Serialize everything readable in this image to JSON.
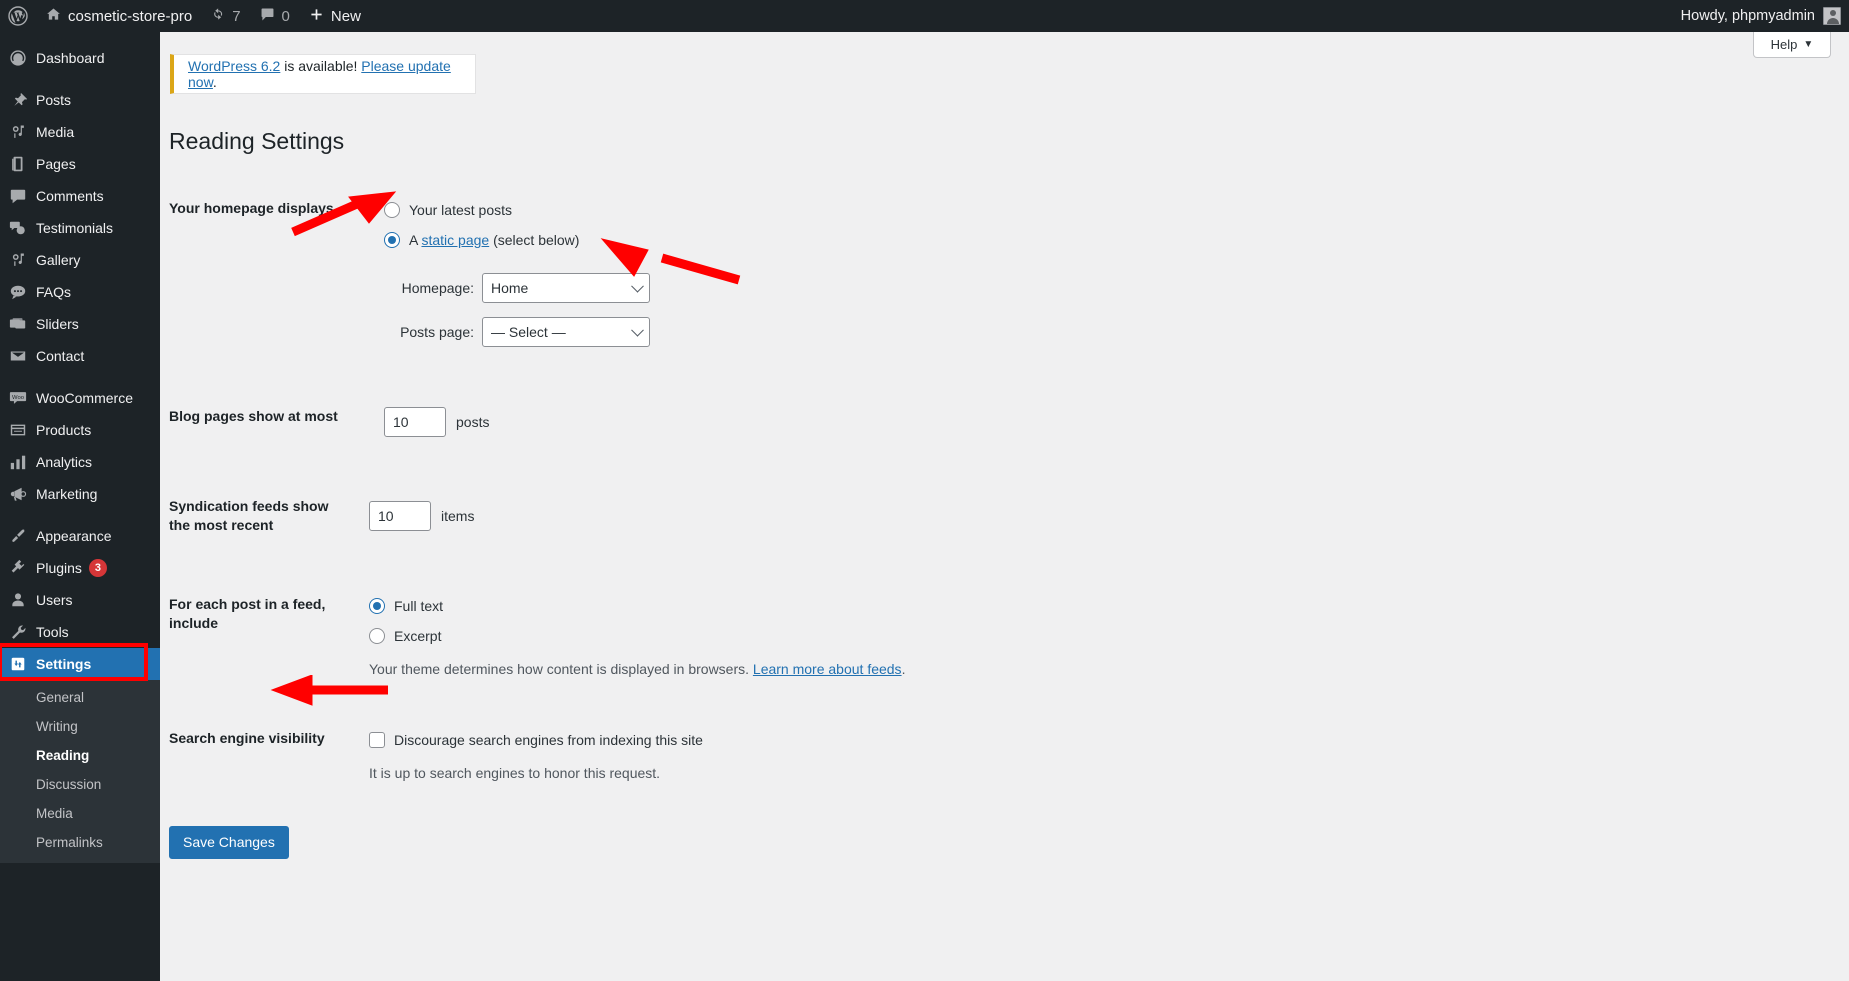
{
  "adminbar": {
    "logo_icon": "wordpress-logo-icon",
    "site_icon": "home-icon",
    "site_name": "cosmetic-store-pro",
    "updates_icon": "updates-icon",
    "updates_count": "7",
    "comments_icon": "comment-bubble-icon",
    "comments_count": "0",
    "new_icon": "plus-icon",
    "new_label": "New",
    "howdy": "Howdy, phpmyadmin",
    "avatar": "user-avatar"
  },
  "sidebar": {
    "items": [
      {
        "label": "Dashboard",
        "icon": "dashboard-icon",
        "sep_after": true
      },
      {
        "label": "Posts",
        "icon": "pin-icon"
      },
      {
        "label": "Media",
        "icon": "media-icon"
      },
      {
        "label": "Pages",
        "icon": "pages-icon"
      },
      {
        "label": "Comments",
        "icon": "comments-icon"
      },
      {
        "label": "Testimonials",
        "icon": "testimonials-icon"
      },
      {
        "label": "Gallery",
        "icon": "gallery-icon"
      },
      {
        "label": "FAQs",
        "icon": "faqs-icon"
      },
      {
        "label": "Sliders",
        "icon": "sliders-icon"
      },
      {
        "label": "Contact",
        "icon": "envelope-icon",
        "sep_after": true
      },
      {
        "label": "WooCommerce",
        "icon": "woocommerce-icon"
      },
      {
        "label": "Products",
        "icon": "products-icon"
      },
      {
        "label": "Analytics",
        "icon": "analytics-icon"
      },
      {
        "label": "Marketing",
        "icon": "marketing-icon",
        "sep_after": true
      },
      {
        "label": "Appearance",
        "icon": "appearance-icon"
      },
      {
        "label": "Plugins",
        "icon": "plugins-icon",
        "badge": "3"
      },
      {
        "label": "Users",
        "icon": "users-icon"
      },
      {
        "label": "Tools",
        "icon": "tools-icon"
      },
      {
        "label": "Settings",
        "icon": "settings-icon",
        "current": true
      }
    ],
    "submenu": [
      {
        "label": "General"
      },
      {
        "label": "Writing"
      },
      {
        "label": "Reading",
        "current": true
      },
      {
        "label": "Discussion"
      },
      {
        "label": "Media"
      },
      {
        "label": "Permalinks"
      }
    ]
  },
  "help": {
    "label": "Help",
    "chevron_icon": "chevron-down-icon"
  },
  "notice": {
    "link_version": "WordPress 6.2",
    "middle": " is available! ",
    "link_update": "Please update now",
    "period": "."
  },
  "page": {
    "title": "Reading Settings"
  },
  "settings": {
    "homepage_displays": {
      "label": "Your homepage displays",
      "option_latest": "Your latest posts",
      "option_static_prefix": "A ",
      "option_static_link": "static page",
      "option_static_suffix": " (select below)",
      "selected": "static",
      "homepage_label": "Homepage:",
      "homepage_value": "Home",
      "postspage_label": "Posts page:",
      "postspage_value": "— Select —"
    },
    "blog_pages": {
      "label": "Blog pages show at most",
      "value": "10",
      "unit": "posts"
    },
    "syndication": {
      "label": "Syndication feeds show the most recent",
      "value": "10",
      "unit": "items"
    },
    "feed_include": {
      "label": "For each post in a feed, include",
      "option_full": "Full text",
      "option_excerpt": "Excerpt",
      "selected": "full",
      "help_prefix": "Your theme determines how content is displayed in browsers. ",
      "help_link": "Learn more about feeds",
      "help_suffix": "."
    },
    "search_visibility": {
      "label": "Search engine visibility",
      "checkbox_label": "Discourage search engines from indexing this site",
      "checked": false,
      "help": "It is up to search engines to honor this request."
    },
    "save_label": "Save Changes"
  },
  "annotations": {
    "color": "#ff0000",
    "arrow_static_page": "red-arrow-pointing-to-static-page-radio",
    "arrow_homepage_dropdown": "red-arrow-pointing-to-homepage-dropdown",
    "arrow_save": "red-arrow-pointing-to-save-changes-button",
    "box_settings": "red-box-around-settings-menu-item"
  }
}
